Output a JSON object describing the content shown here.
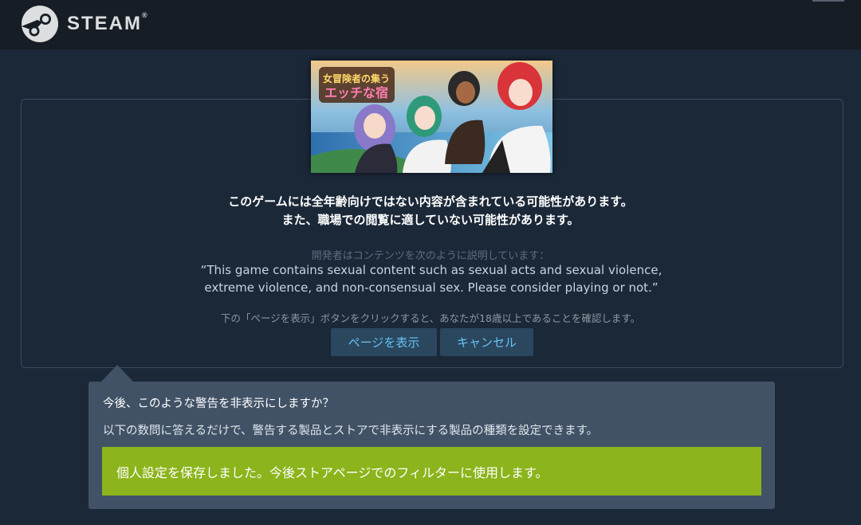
{
  "header": {
    "logo_text": "STEAM",
    "logo_trademark": "®"
  },
  "capsule": {
    "title_art_text": "女冒険者の集うエッチな宿"
  },
  "warning": {
    "line1": "このゲームには全年齢向けではない内容が含まれている可能性があります。",
    "line2": "また、職場での閲覧に適していない可能性があります。",
    "developer_label": "開発者はコンテンツを次のように説明しています：",
    "developer_description": "“This game contains sexual content such as sexual acts and sexual violence, extreme violence, and non-consensual sex. Please consider playing or not.”",
    "confirm_text": "下の「ページを表示」ボタンをクリックすると、あなたが18歳以上であることを確認します。",
    "view_page_label": "ページを表示",
    "cancel_label": "キャンセル"
  },
  "preferences": {
    "title": "今後、このような警告を非表示にしますか？",
    "description": "以下の数問に答えるだけで、警告する製品とストアで非表示にする製品の種類を設定できます。",
    "saved_message": "個人設定を保存しました。今後ストアページでのフィルターに使用します。"
  },
  "colors": {
    "background": "#1b2838",
    "header": "#171d25",
    "button_bg": "#2a475e",
    "button_text": "#67c1f5",
    "panel_bg": "#415266",
    "saved_bg": "#8cb41c"
  }
}
